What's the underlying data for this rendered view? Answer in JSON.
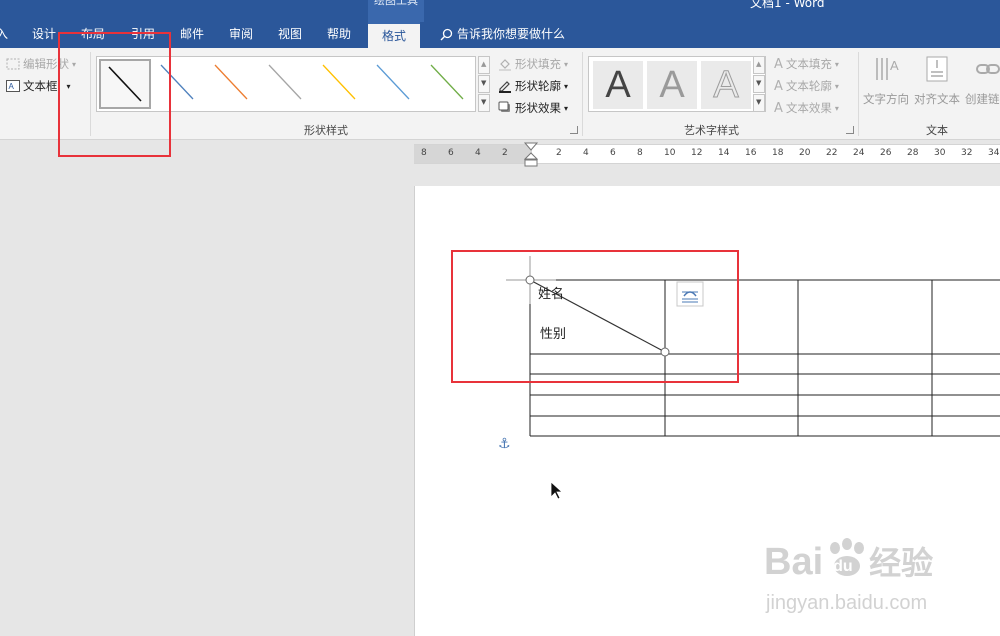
{
  "window": {
    "title": "文档1 - Word",
    "context_tab_label": "绘图工具"
  },
  "tabs": [
    {
      "label": "入"
    },
    {
      "label": "设计"
    },
    {
      "label": "布局"
    },
    {
      "label": "引用"
    },
    {
      "label": "邮件"
    },
    {
      "label": "审阅"
    },
    {
      "label": "视图"
    },
    {
      "label": "帮助"
    },
    {
      "label": "格式",
      "active": true
    }
  ],
  "tell_me": {
    "label": "告诉我你想要做什么"
  },
  "ribbon": {
    "insert_shapes": {
      "edit_shape": "编辑形状",
      "text_box": "文本框"
    },
    "shape_styles": {
      "label": "形状样式",
      "fill": "形状填充",
      "outline": "形状轮廓",
      "effects": "形状效果",
      "line_colors": [
        "#111111",
        "#4f81bd",
        "#ed7d31",
        "#a5a5a5",
        "#ffc000",
        "#5b9bd5",
        "#70ad47"
      ]
    },
    "wordart_styles": {
      "label": "艺术字样式",
      "letter": "A",
      "text_fill": "文本填充",
      "text_outline": "文本轮廓",
      "text_effects": "文本效果"
    },
    "text": {
      "label": "文本",
      "text_direction": "文字方向",
      "align_text": "对齐文本",
      "create_link": "创建链接"
    }
  },
  "ruler": {
    "labels": [
      "8",
      "6",
      "4",
      "2",
      "2",
      "4",
      "6",
      "8",
      "10",
      "12",
      "14",
      "16",
      "18",
      "20",
      "22",
      "24",
      "26",
      "28",
      "30",
      "32",
      "34"
    ]
  },
  "document": {
    "table": {
      "header_top_text": "姓名",
      "header_bottom_text": "性别"
    }
  },
  "watermark": {
    "brand": "Bai",
    "brand_du": "du",
    "brand_cn": "经验",
    "url": "jingyan.baidu.com"
  },
  "colors": {
    "accent": "#2b579a",
    "highlight": "#e8323a"
  }
}
